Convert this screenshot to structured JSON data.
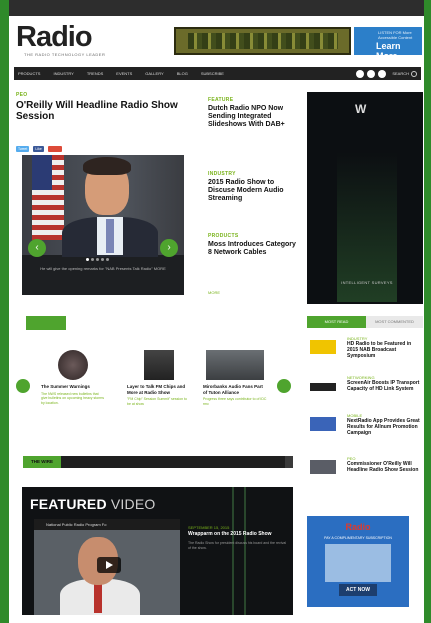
{
  "topbar": {
    "items": [
      "",
      "",
      "",
      "",
      "",
      "",
      "",
      ""
    ]
  },
  "brand": {
    "logo": "Radio",
    "tagline": "THE RADIO TECHNOLOGY LEADER"
  },
  "header_ad": {
    "small": "LISTEN FOR\nMore Accessible Content",
    "cta": "Learn More"
  },
  "nav": {
    "items": [
      "PRODUCTS",
      "INDUSTRY",
      "TRENDS",
      "EVENTS",
      "GALLERY",
      "BLOG",
      "SUBSCRIBE"
    ],
    "search": "SEARCH"
  },
  "lead": {
    "kicker": "PEO",
    "headline": "O'Reilly Will Headline Radio Show Session",
    "shares": [
      "Tweet",
      "Like",
      ""
    ],
    "caption": "He will give the opening remarks for \"NAB Presents\nTalk Radio\" MORE"
  },
  "right_stories": [
    {
      "kicker": "FEATURE",
      "headline": "Dutch Radio NPO Now Sending Integrated Slideshows With DAB+"
    },
    {
      "kicker": "INDUSTRY",
      "headline": "2015 Radio Show to Discuse Modern Audio Streaming"
    },
    {
      "kicker": "PRODUCTS",
      "headline": "Moss Introduces Category 8 Network Cables"
    }
  ],
  "right_more": "MORE",
  "side_ad": {
    "label": "INTELLIGENT SURVEYS"
  },
  "side_tabs": {
    "active": "MOST READ",
    "inactive": "MOST COMMENTED"
  },
  "side_stories": [
    {
      "kicker": "INDUSTRY",
      "headline": "HD Radio to be Featured in 2015 NAB Broadcast Symposium"
    },
    {
      "kicker": "NETWORKING",
      "headline": "ScreenAir Boosts IP Transport Capacity of HD Link System"
    },
    {
      "kicker": "MOBILE",
      "headline": "NextRadio App Provides Great Results for Allnum Promotion Campaign"
    },
    {
      "kicker": "PEO",
      "headline": "Commissioner O'Reilly Will Headline Radio Show Session"
    }
  ],
  "section_tab": "",
  "carousel": [
    {
      "title": "The Summer Warnings",
      "desc": "The NWS released new bulletins that give bulletins on upcoming heavy storms by location."
    },
    {
      "title": "Layer to Talk FM Chips and More at Radio Show",
      "desc": "\"FM Chip\" Session\nSummit\" session to be at show"
    },
    {
      "title": "Mirorbanks Audio Fans Part of Tuton Alliance",
      "desc": "Progress three says contributor to of IDC rmc"
    }
  ],
  "wire": {
    "label": "THE WIRE",
    "ticker": [
      "",
      ""
    ]
  },
  "featured_video": {
    "title_bold": "FEATURED",
    "title_light": "VIDEO",
    "video_title": "National Public Radio Program Fo",
    "kicker": "SEPTEMBER 15, 2015",
    "headline": "Wrapparm on the 2015 Radio Show",
    "desc": "The Radio Show for president discuss\nhis board and the revival of the show."
  },
  "bottom_ad": {
    "brand": "Radio",
    "sub": "PAY A COMPLIMENTARY SUBSCRIPTION",
    "cta": "ACT NOW"
  }
}
